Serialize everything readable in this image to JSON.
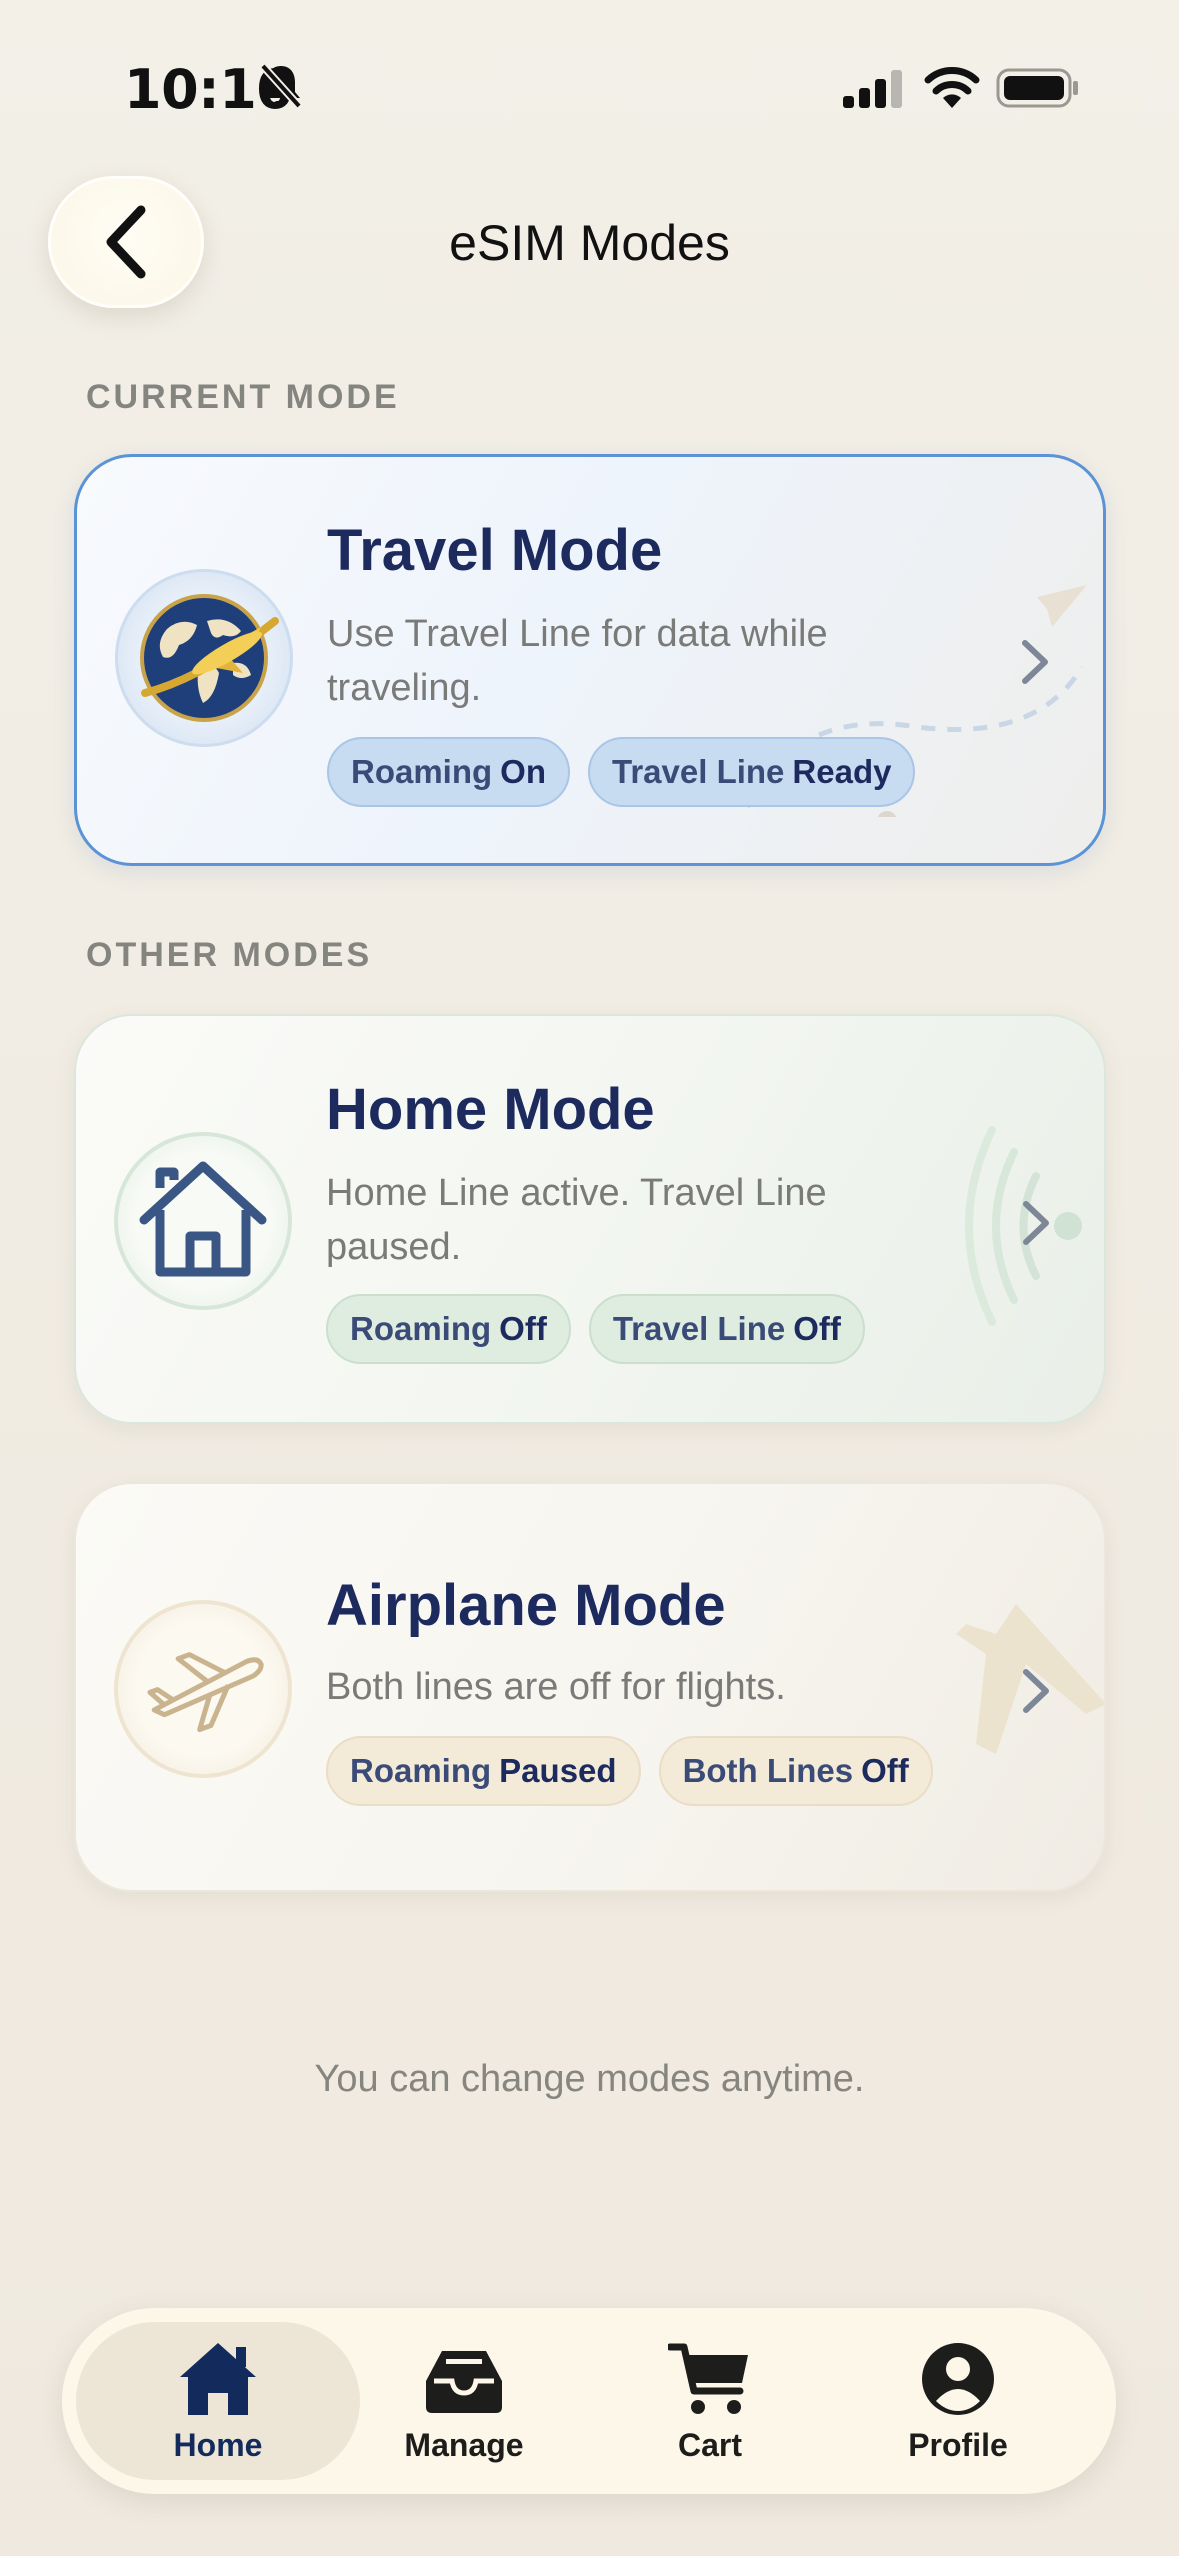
{
  "status_bar": {
    "time": "10:10",
    "icons": [
      "bell-slash-icon",
      "cellular-signal-icon",
      "wifi-icon",
      "battery-icon"
    ]
  },
  "header": {
    "title": "eSIM Modes",
    "back_icon": "chevron-left-icon"
  },
  "sections": {
    "current_label": "CURRENT MODE",
    "other_label": "OTHER MODES"
  },
  "modes": [
    {
      "title": "Travel Mode",
      "description": "Use Travel Line for data while traveling.",
      "icon": "globe-airplane-icon",
      "chips": [
        {
          "prefix": "Roaming",
          "value": "On"
        },
        {
          "prefix": "Travel Line",
          "value": "Ready"
        }
      ],
      "current": true
    },
    {
      "title": "Home Mode",
      "description": "Home Line active. Travel Line paused.",
      "icon": "house-icon",
      "chips": [
        {
          "prefix": "Roaming",
          "value": "Off"
        },
        {
          "prefix": "Travel Line",
          "value": "Off"
        }
      ],
      "current": false
    },
    {
      "title": "Airplane Mode",
      "description": "Both lines are off for flights.",
      "icon": "airplane-icon",
      "chips": [
        {
          "prefix": "Roaming",
          "value": "Paused"
        },
        {
          "prefix": "Both Lines",
          "value": "Off"
        }
      ],
      "current": false
    }
  ],
  "footer_note": "You can change modes anytime.",
  "tab_bar": {
    "active": "Home",
    "tabs": [
      {
        "label": "Home",
        "icon": "home-icon"
      },
      {
        "label": "Manage",
        "icon": "inbox-tray-icon"
      },
      {
        "label": "Cart",
        "icon": "cart-icon"
      },
      {
        "label": "Profile",
        "icon": "profile-icon"
      }
    ]
  },
  "colors": {
    "accent_blue": "#5b93d6",
    "title_navy": "#1c2a5e",
    "background": "#f2efe7"
  }
}
